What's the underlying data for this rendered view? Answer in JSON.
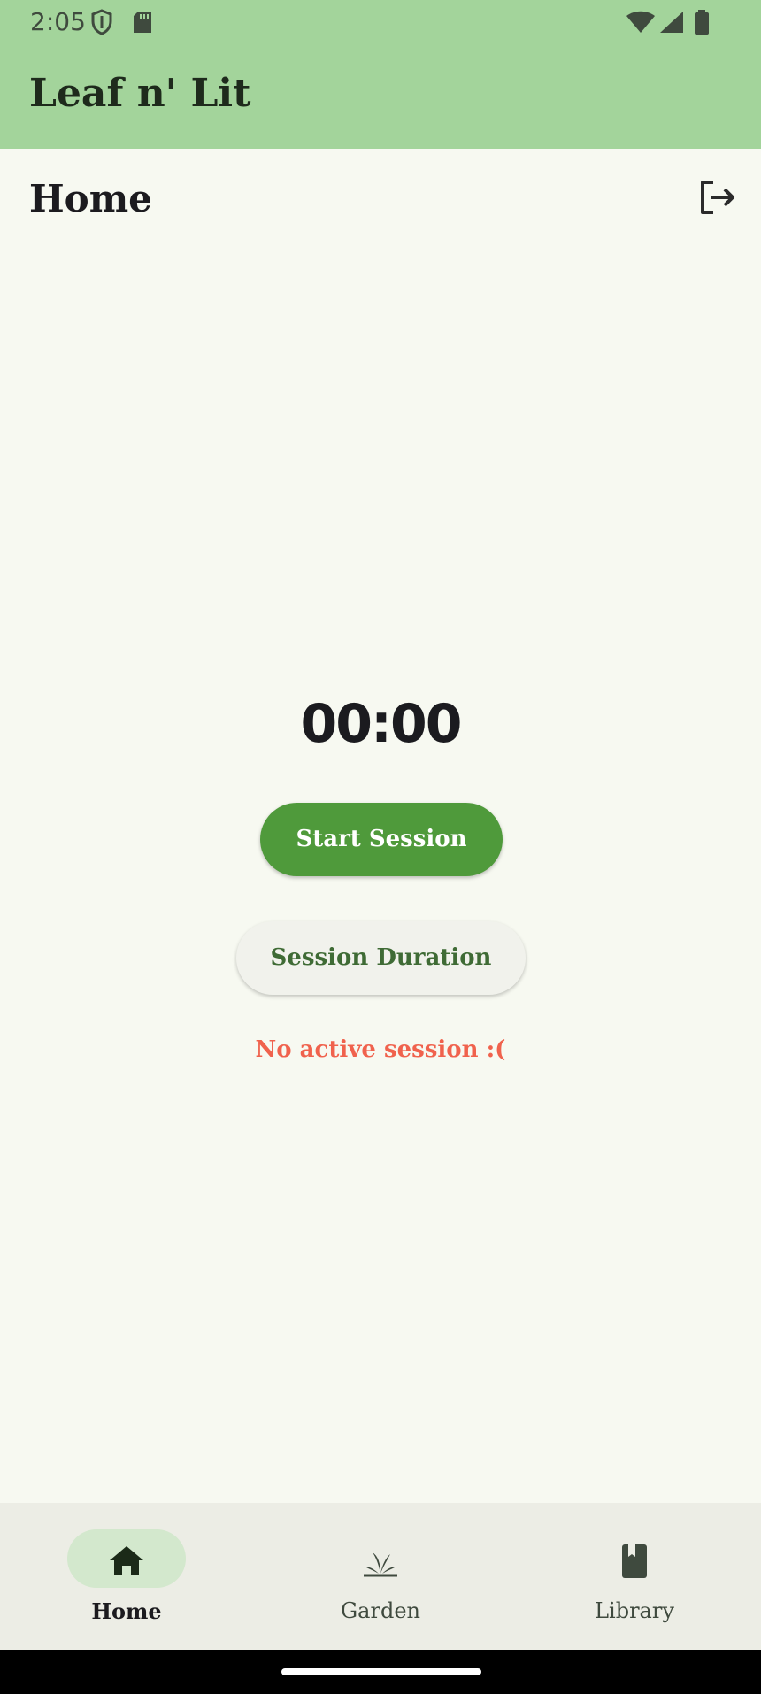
{
  "status_bar": {
    "time": "2:05",
    "icons": [
      "shield-icon",
      "sd-card-icon",
      "wifi-icon",
      "signal-icon",
      "battery-icon"
    ]
  },
  "app_bar": {
    "title": "Leaf n' Lit",
    "background": "#a3d49b"
  },
  "page": {
    "title": "Home",
    "logout_icon": "logout-icon"
  },
  "timer": {
    "value": "00:00"
  },
  "buttons": {
    "start_session": "Start Session",
    "session_duration": "Session Duration"
  },
  "session_status": {
    "text": "No active session :(",
    "color": "#f0624d"
  },
  "bottom_nav": {
    "items": [
      {
        "label": "Home",
        "icon": "home-icon",
        "active": true
      },
      {
        "label": "Garden",
        "icon": "garden-icon",
        "active": false
      },
      {
        "label": "Library",
        "icon": "library-icon",
        "active": false
      }
    ]
  },
  "colors": {
    "accent": "#4f9a3b",
    "page_background": "#f7f9f1",
    "nav_background": "#ecede5",
    "nav_active_pill": "#d3e8cd"
  }
}
